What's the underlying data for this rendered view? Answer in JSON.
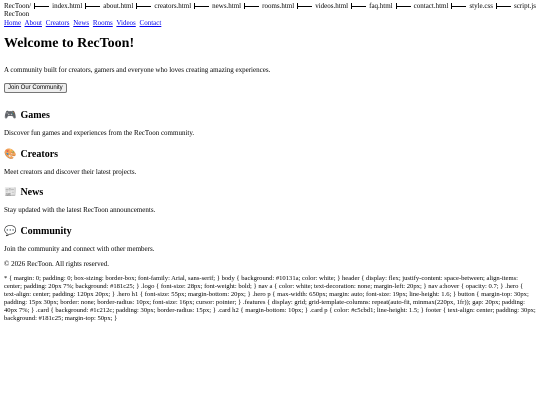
{
  "tree": {
    "root": "RecToon/",
    "files": [
      "index.html",
      "about.html",
      "creators.html",
      "news.html",
      "rooms.html",
      "videos.html",
      "faq.html",
      "contact.html",
      "style.css",
      "script.js"
    ]
  },
  "header": {
    "logo": "RecToon",
    "nav": [
      "Home",
      "About",
      "Creators",
      "News",
      "Rooms",
      "Videos",
      "Contact"
    ]
  },
  "hero": {
    "title": "Welcome to RecToon!",
    "subtitle": "A community built for creators, gamers and everyone who loves creating amazing experiences.",
    "button": "Join Our Community"
  },
  "sections": [
    {
      "icon": "🎮",
      "icon_name": "game-controller-icon",
      "title": "Games",
      "text": "Discover fun games and experiences from the RecToon community."
    },
    {
      "icon": "🎨",
      "icon_name": "palette-icon",
      "title": "Creators",
      "text": "Meet creators and discover their latest projects."
    },
    {
      "icon": "📰",
      "icon_name": "newspaper-icon",
      "title": "News",
      "text": "Stay updated with the latest RecToon announcements."
    },
    {
      "icon": "💬",
      "icon_name": "speech-bubble-icon",
      "title": "Community",
      "text": "Join the community and connect with other members."
    }
  ],
  "footer": {
    "text": "© 2026 RecToon. All rights reserved."
  },
  "css_dump": "* { margin: 0; padding: 0; box-sizing: border-box; font-family: Arial, sans-serif; } body { background: #10131a; color: white; } header { display: flex; justify-content: space-between; align-items: center; padding: 20px 7%; background: #181c25; } .logo { font-size: 28px; font-weight: bold; } nav a { color: white; text-decoration: none; margin-left: 20px; } nav a:hover { opacity: 0.7; } .hero { text-align: center; padding: 120px 20px; } .hero h1 { font-size: 55px; margin-bottom: 20px; } .hero p { max-width: 650px; margin: auto; font-size: 19px; line-height: 1.6; } button { margin-top: 30px; padding: 15px 30px; border: none; border-radius: 10px; font-size: 16px; cursor: pointer; } .features { display: grid; grid-template-columns: repeat(auto-fit, minmax(220px, 1fr)); gap: 20px; padding: 40px 7%; } .card { background: #1c212c; padding: 30px; border-radius: 15px; } .card h2 { margin-bottom: 10px; } .card p { color: #c5cbd1; line-height: 1.5; } footer { text-align: center; padding: 30px; background: #181c25; margin-top: 50px; }"
}
